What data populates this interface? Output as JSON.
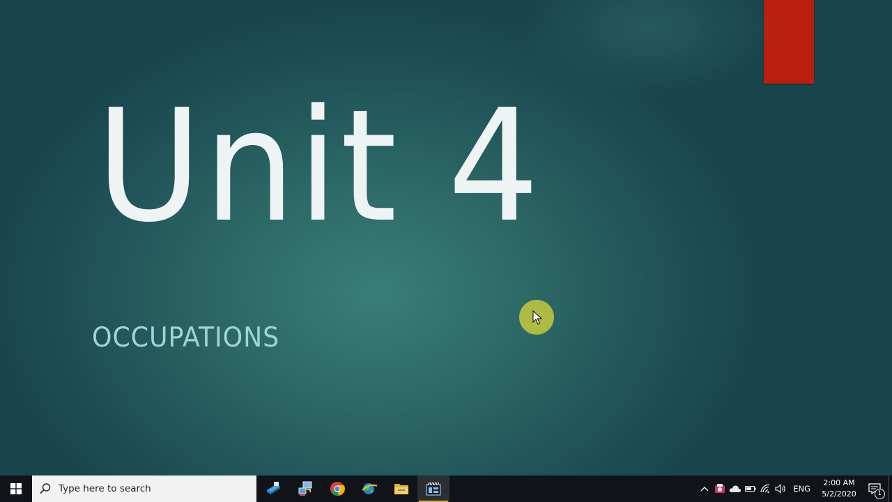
{
  "slide": {
    "title": "Unit 4",
    "subtitle": "OCCUPATIONS"
  },
  "taskbar": {
    "search_placeholder": "Type here to search",
    "apps": [
      {
        "name": "network-computer-icon"
      },
      {
        "name": "connect-icon"
      },
      {
        "name": "chrome-icon"
      },
      {
        "name": "edge-globe-icon"
      },
      {
        "name": "file-explorer-icon"
      },
      {
        "name": "recorder-app-icon",
        "active": true
      }
    ],
    "tray": {
      "language": "ENG",
      "time": "2:00 AM",
      "date": "5/2/2020",
      "notification_count": "1"
    }
  },
  "colors": {
    "background": "#2c6866",
    "title": "#eef3f3",
    "subtitle": "#9fd4d8",
    "red_accent": "#b81f0f",
    "taskbar": "#101418",
    "active_indicator": "#e8a82a"
  }
}
